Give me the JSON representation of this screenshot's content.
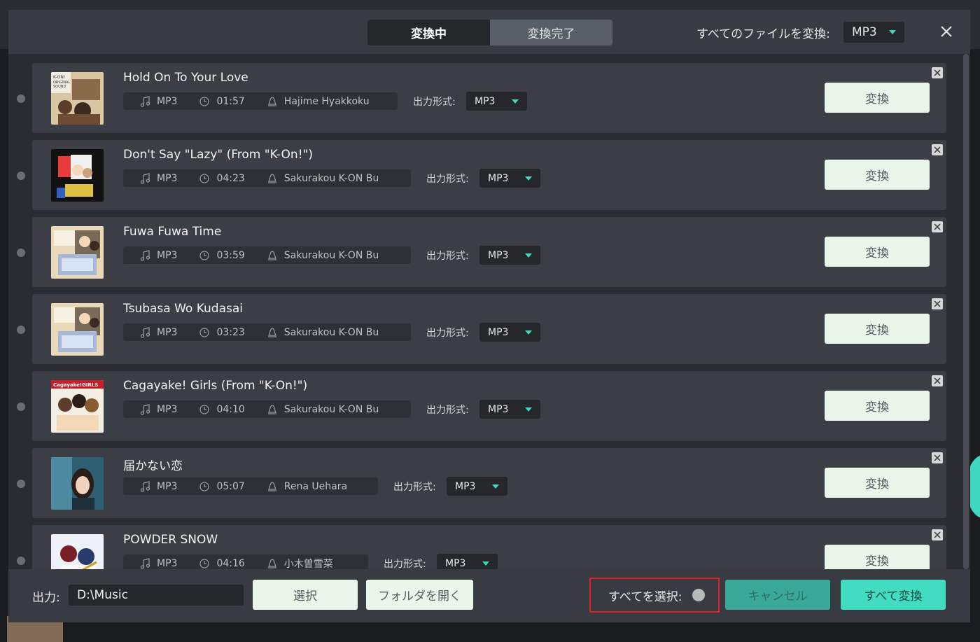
{
  "header": {
    "tabs": [
      {
        "label": "変換中",
        "active": true
      },
      {
        "label": "変換完了",
        "active": false
      }
    ],
    "convert_all_label": "すべてのファイルを変換:",
    "convert_all_format": "MP3"
  },
  "rows": [
    {
      "title": "Hold On To Your Love",
      "format": "MP3",
      "duration": "01:57",
      "artist": "Hajime Hyakkoku",
      "output_label": "出力形式:",
      "output_format": "MP3",
      "convert_label": "変換",
      "cover": "k-on-ost"
    },
    {
      "title": "Don't Say \"Lazy\" (From \"K-On!\")",
      "format": "MP3",
      "duration": "04:23",
      "artist": "Sakurakou K-ON Bu",
      "output_label": "出力形式:",
      "output_format": "MP3",
      "convert_label": "変換",
      "cover": "dont-say-lazy"
    },
    {
      "title": "Fuwa Fuwa Time",
      "format": "MP3",
      "duration": "03:59",
      "artist": "Sakurakou K-ON Bu",
      "output_label": "出力形式:",
      "output_format": "MP3",
      "convert_label": "変換",
      "cover": "fuwa-fuwa"
    },
    {
      "title": "Tsubasa Wo Kudasai",
      "format": "MP3",
      "duration": "03:23",
      "artist": "Sakurakou K-ON Bu",
      "output_label": "出力形式:",
      "output_format": "MP3",
      "convert_label": "変換",
      "cover": "fuwa-fuwa"
    },
    {
      "title": "Cagayake! Girls (From \"K-On!\")",
      "format": "MP3",
      "duration": "04:10",
      "artist": "Sakurakou K-ON Bu",
      "output_label": "出力形式:",
      "output_format": "MP3",
      "convert_label": "変換",
      "cover": "cagayake"
    },
    {
      "title": "届かない恋",
      "format": "MP3",
      "duration": "05:07",
      "artist": "Rena Uehara",
      "output_label": "出力形式:",
      "output_format": "MP3",
      "convert_label": "変換",
      "cover": "rena"
    },
    {
      "title": "POWDER SNOW",
      "format": "MP3",
      "duration": "04:16",
      "artist": "小木曽雪菜",
      "output_label": "出力形式:",
      "output_format": "MP3",
      "convert_label": "変換",
      "cover": "powder-snow"
    }
  ],
  "footer": {
    "output_label": "出力:",
    "output_path": "D:\\Music",
    "select_label": "選択",
    "open_folder_label": "フォルダを開く",
    "select_all_label": "すべてを選択:",
    "cancel_label": "キャンセル",
    "convert_all_label": "すべて変換"
  },
  "colors": {
    "accent": "#42dcc2",
    "highlight_border": "#e0202a",
    "button_light": "#eaf6ea"
  }
}
